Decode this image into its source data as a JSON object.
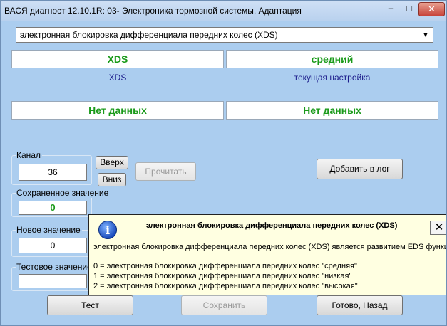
{
  "window": {
    "title": "ВАСЯ диагност 12.10.1R: 03- Электроника тормозной системы, Адаптация",
    "minimize_glyph": "–",
    "maximize_glyph": "□",
    "close_glyph": "✕"
  },
  "function_select": {
    "selected": "электронная блокировка дифференциала передних колес (XDS)",
    "arrow_glyph": "▼"
  },
  "value_panels": {
    "left_value": "XDS",
    "left_caption": "XDS",
    "right_value": "средний",
    "right_caption": "текущая настройка",
    "left_value_2": "Нет данных",
    "right_value_2": "Нет данных"
  },
  "channel": {
    "label": "Канал",
    "value": "36",
    "up_label": "Вверх",
    "down_label": "Вниз",
    "read_label": "Прочитать"
  },
  "saved_value": {
    "label": "Сохраненное значение",
    "value": "0"
  },
  "new_value": {
    "label": "Новое значение",
    "value": "0"
  },
  "test_value": {
    "label": "Тестовое значение",
    "value": ""
  },
  "buttons": {
    "add_log": "Добавить в лог",
    "test": "Тест",
    "save": "Сохранить",
    "done": "Готово, Назад"
  },
  "tooltip": {
    "icon_glyph": "i",
    "title": "электронная блокировка дифференциала передних колес (XDS)",
    "close_glyph": "✕",
    "description": "электронная блокировка дифференциала передних колес (XDS) является развитием EDS функции",
    "options": [
      "0 = электронная блокировка дифференциала передних колес \"средняя\"",
      "1 = электронная блокировка дифференциала передних колес \"низкая\"",
      "2 = электронная блокировка дифференциала передних колес \"высокая\""
    ]
  }
}
